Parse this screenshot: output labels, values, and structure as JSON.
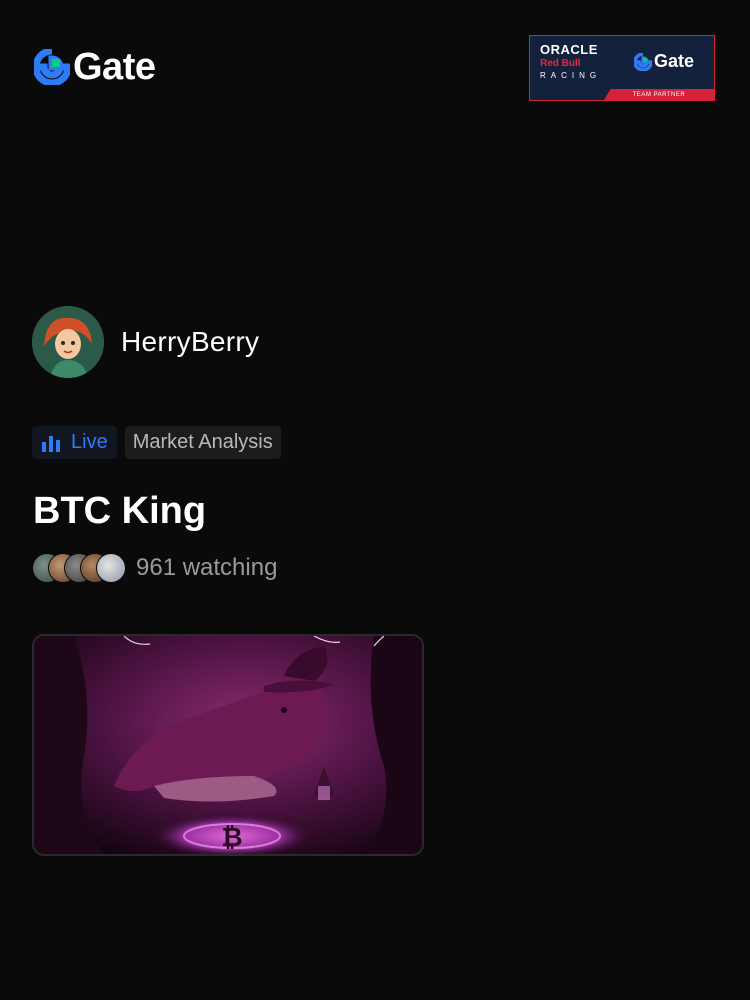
{
  "brand": {
    "name": "Gate",
    "accent": "#2f7bf6",
    "secondary": "#00d17c"
  },
  "partner_badge": {
    "oracle": "ORACLE",
    "redbull": "Red Bull",
    "racing": "RACING",
    "gate": "Gate",
    "tagline": "TEAM PARTNER"
  },
  "streamer": {
    "name": "HerryBerry",
    "avatar": "avatar-illustration"
  },
  "tags": {
    "live": "Live",
    "category": "Market Analysis"
  },
  "stream": {
    "title": "BTC King",
    "watching": "961 watching",
    "thumbnail": "whale-wizard-bitcoin-artwork"
  },
  "icons": {
    "live": "bar-chart-icon",
    "logo": "gate-logo-icon"
  }
}
